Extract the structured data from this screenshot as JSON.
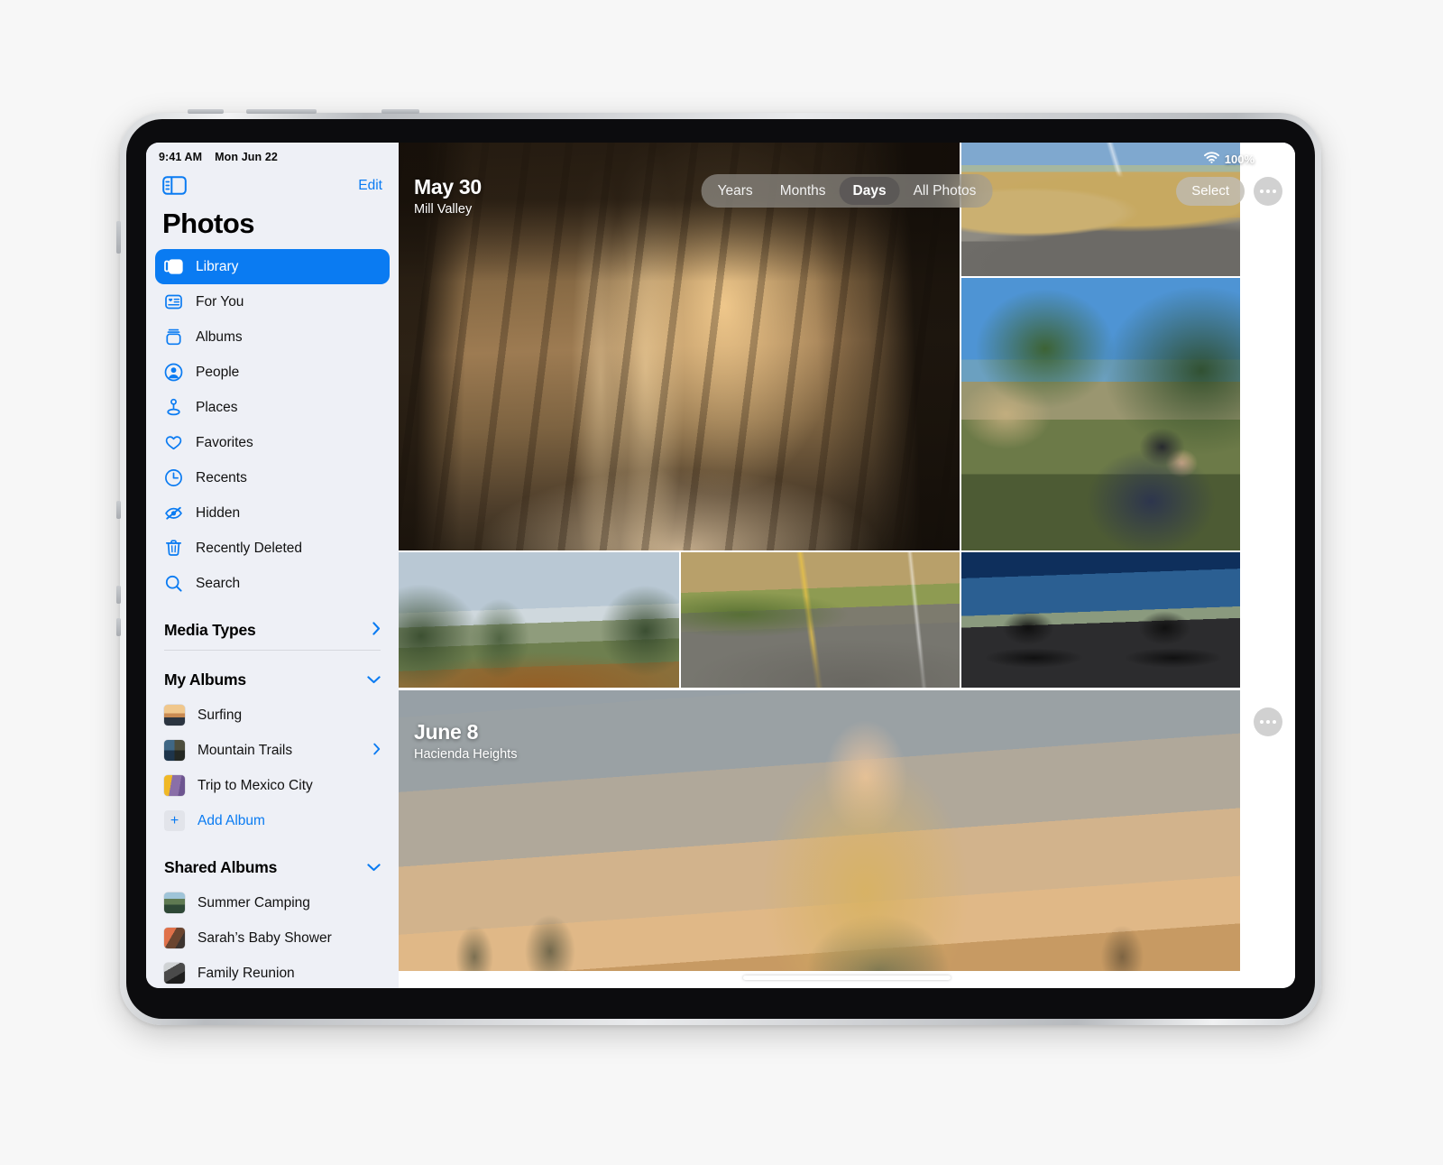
{
  "status_bar": {
    "time": "9:41 AM",
    "date": "Mon Jun 22",
    "battery_percent": "100%",
    "wifi_icon": "wifi-icon",
    "battery_icon": "battery-icon"
  },
  "sidebar": {
    "toggle_icon": "sidebar-toggle-icon",
    "edit_label": "Edit",
    "app_title": "Photos",
    "nav_items": [
      {
        "label": "Library",
        "icon": "photo-stack-icon",
        "selected": true
      },
      {
        "label": "For You",
        "icon": "for-you-icon",
        "selected": false
      },
      {
        "label": "Albums",
        "icon": "albums-icon",
        "selected": false
      },
      {
        "label": "People",
        "icon": "person-circle-icon",
        "selected": false
      },
      {
        "label": "Places",
        "icon": "map-pin-icon",
        "selected": false
      },
      {
        "label": "Favorites",
        "icon": "heart-icon",
        "selected": false
      },
      {
        "label": "Recents",
        "icon": "clock-icon",
        "selected": false
      },
      {
        "label": "Hidden",
        "icon": "eye-slash-icon",
        "selected": false
      },
      {
        "label": "Recently Deleted",
        "icon": "trash-icon",
        "selected": false
      },
      {
        "label": "Search",
        "icon": "search-icon",
        "selected": false
      }
    ],
    "media_types": {
      "label": "Media Types",
      "chevron": "chevron-right-icon"
    },
    "my_albums": {
      "label": "My Albums",
      "chevron": "chevron-down-icon",
      "items": [
        {
          "label": "Surfing",
          "chevron": ""
        },
        {
          "label": "Mountain Trails",
          "chevron": "chevron-right-icon"
        },
        {
          "label": "Trip to Mexico City",
          "chevron": ""
        }
      ],
      "add_album_label": "Add Album",
      "add_album_icon": "plus-icon"
    },
    "shared_albums": {
      "label": "Shared Albums",
      "chevron": "chevron-down-icon",
      "items": [
        {
          "label": "Summer Camping"
        },
        {
          "label": "Sarah’s Baby Shower"
        },
        {
          "label": "Family Reunion"
        }
      ]
    }
  },
  "main": {
    "segmented_control": {
      "options": [
        "Years",
        "Months",
        "Days",
        "All Photos"
      ],
      "selected": "Days"
    },
    "toolbar": {
      "select_label": "Select",
      "more_icon": "ellipsis-icon"
    },
    "day_groups": [
      {
        "date": "May 30",
        "place": "Mill Valley",
        "more_icon": "ellipsis-icon"
      },
      {
        "date": "June 8",
        "place": "Hacienda Heights",
        "more_icon": "ellipsis-icon"
      }
    ],
    "photos": [
      {
        "name": "forest-road-cyclists-photo"
      },
      {
        "name": "hillside-curve-cyclists-photo"
      },
      {
        "name": "cyclist-portrait-photo"
      },
      {
        "name": "foggy-ridge-trees-photo"
      },
      {
        "name": "winding-road-cyclists-photo"
      },
      {
        "name": "silhouette-cyclists-sunset-photo"
      },
      {
        "name": "woman-sunset-portrait-photo"
      }
    ]
  },
  "colors": {
    "accent": "#0a7bf2",
    "sidebar_bg": "#eef0f6",
    "selected_text": "#ffffff"
  }
}
